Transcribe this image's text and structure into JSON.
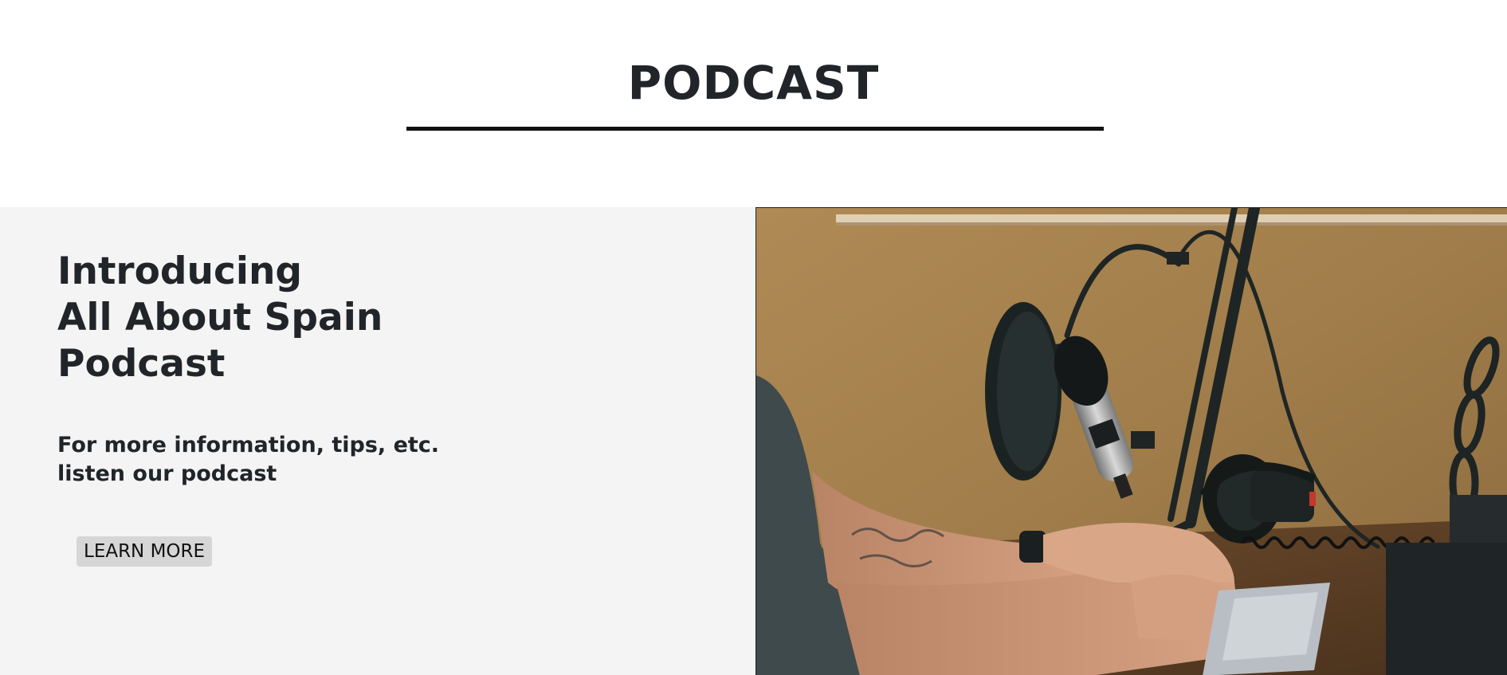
{
  "page": {
    "title": "PODCAST"
  },
  "feature": {
    "heading_lines": [
      "Introducing",
      "All About Spain",
      "Podcast"
    ],
    "description_lines": [
      "For more information, tips, etc.",
      "listen our podcast"
    ],
    "button_label": "LEARN MORE"
  },
  "photo": {
    "icon": "podcast-studio-photo"
  },
  "colors": {
    "panel_background": "#f4f4f4",
    "button_background": "#d6d6d6",
    "text": "#212529"
  }
}
